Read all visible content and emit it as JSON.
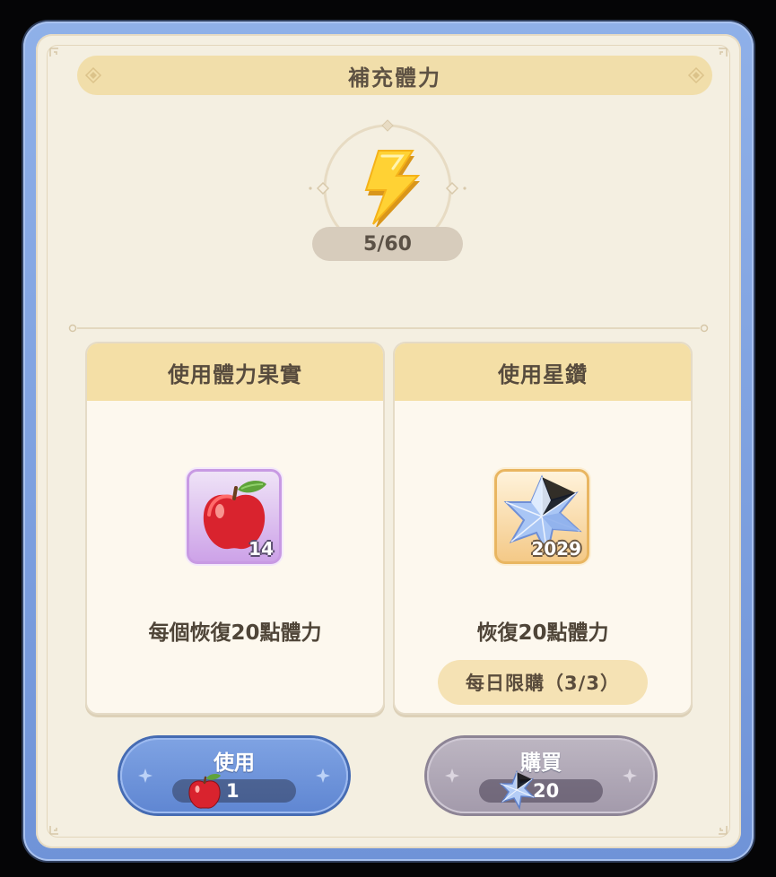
{
  "dialog": {
    "title": "補充體力",
    "energy_counter": "5/60",
    "energy_icon": "lightning-bolt-icon"
  },
  "options": {
    "fruit": {
      "header": "使用體力果實",
      "item_icon": "apple-icon",
      "item_count": "14",
      "description": "每個恢復20點體力",
      "button_label": "使用",
      "cost_icon": "apple-icon",
      "cost_value": "1"
    },
    "diamond": {
      "header": "使用星鑽",
      "item_icon": "star-diamond-icon",
      "item_count": "2029",
      "description": "恢復20點體力",
      "daily_limit": "每日限購（3/3）",
      "button_label": "購買",
      "cost_icon": "star-diamond-icon",
      "cost_value": "20"
    }
  },
  "colors": {
    "frame_blue": "#6f93d8",
    "panel_cream": "#f4efe1",
    "header_gold": "#f4dfa6",
    "use_button": "#6f93d8",
    "buy_button_disabled": "#a39aab"
  }
}
